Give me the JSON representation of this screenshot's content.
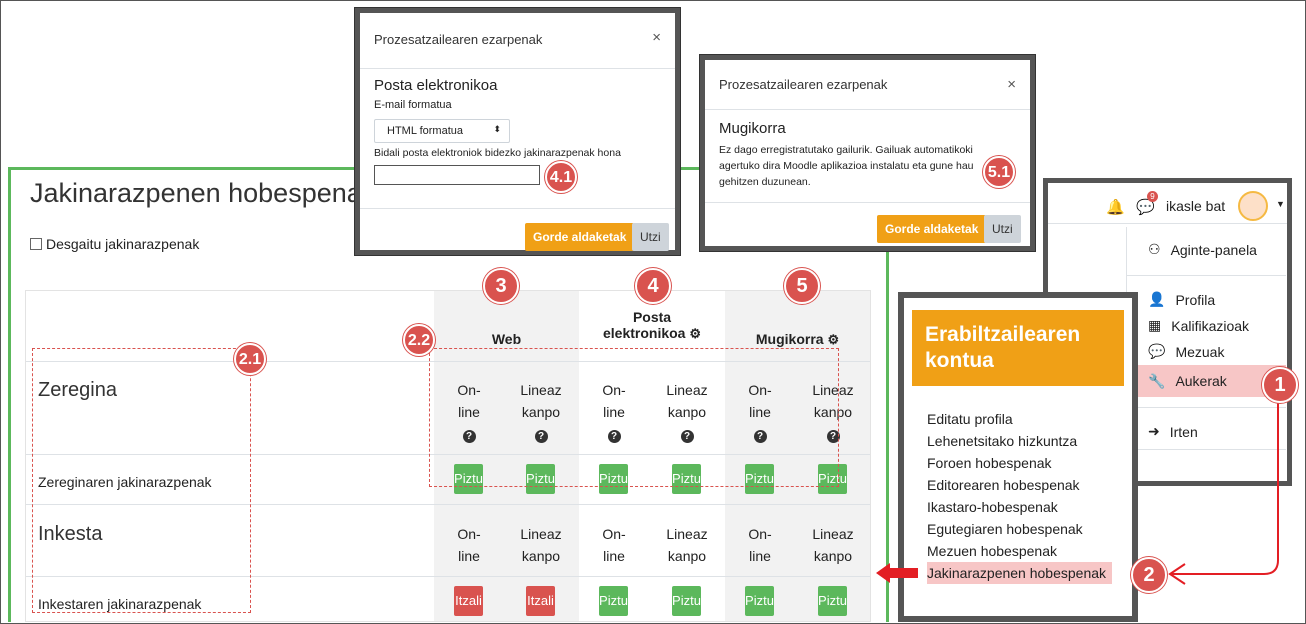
{
  "page": {
    "title": "Jakinarazpenen hobespenak",
    "disable_label": "Desgaitu jakinarazpenak"
  },
  "table": {
    "groups": {
      "web": "Web",
      "email_line1": "Posta",
      "email_line2": "elektronikoa",
      "mobile": "Mugikorra"
    },
    "online1": "On-",
    "online2": "line",
    "offline1": "Lineaz",
    "offline2": "kanpo",
    "sections": [
      {
        "title": "Zeregina",
        "row": "Zereginaren jakinarazpenak",
        "states": [
          "Piztu",
          "Piztu",
          "Piztu",
          "Piztu",
          "Piztu",
          "Piztu"
        ]
      },
      {
        "title": "Inkesta",
        "row": "Inkestaren jakinarazpenak",
        "states": [
          "Itzali",
          "Itzali",
          "Piztu",
          "Piztu",
          "Piztu",
          "Piztu"
        ]
      }
    ]
  },
  "modal_email": {
    "header": "Prozesatzailearen ezarpenak",
    "title": "Posta elektronikoa",
    "format_label": "E-mail formatua",
    "format_value": "HTML formatua",
    "send_label": "Bidali posta elektroniok bidezko jakinarazpenak hona",
    "send_value": "",
    "save": "Gorde aldaketak",
    "cancel": "Utzi"
  },
  "modal_mobile": {
    "header": "Prozesatzailearen ezarpenak",
    "title": "Mugikorra",
    "body1": "Ez dago erregistratutako gailurik. Gailuak automatikoki",
    "body2": "agertuko dira Moodle aplikazioa instalatu eta gune hau",
    "body3": "gehitzen duzunean.",
    "save": "Gorde aldaketak",
    "cancel": "Utzi"
  },
  "navbar": {
    "username": "ikasle bat",
    "msg_count": "9"
  },
  "user_menu": {
    "items": [
      "Aginte-panela",
      "Profila",
      "Kalifikazioak",
      "Mezuak",
      "Aukerak",
      "Irten"
    ]
  },
  "account": {
    "title_line1": "Erabiltzailearen",
    "title_line2": "kontua",
    "links": [
      "Editatu profila",
      "Lehenetsitako hizkuntza",
      "Foroen hobespenak",
      "Editorearen hobespenak",
      "Ikastaro-hobespenak",
      "Egutegiaren hobespenak",
      "Mezuen hobespenak",
      "Jakinarazpenen hobespenak"
    ]
  },
  "badges": {
    "b1": "1",
    "b2": "2",
    "b21": "2.1",
    "b22": "2.2",
    "b3": "3",
    "b4": "4",
    "b41": "4.1",
    "b5": "5",
    "b51": "5.1"
  },
  "colors": {
    "accent": "#f0a016",
    "on": "#5cb85c",
    "off": "#d9534f",
    "badge": "#d9534f"
  }
}
